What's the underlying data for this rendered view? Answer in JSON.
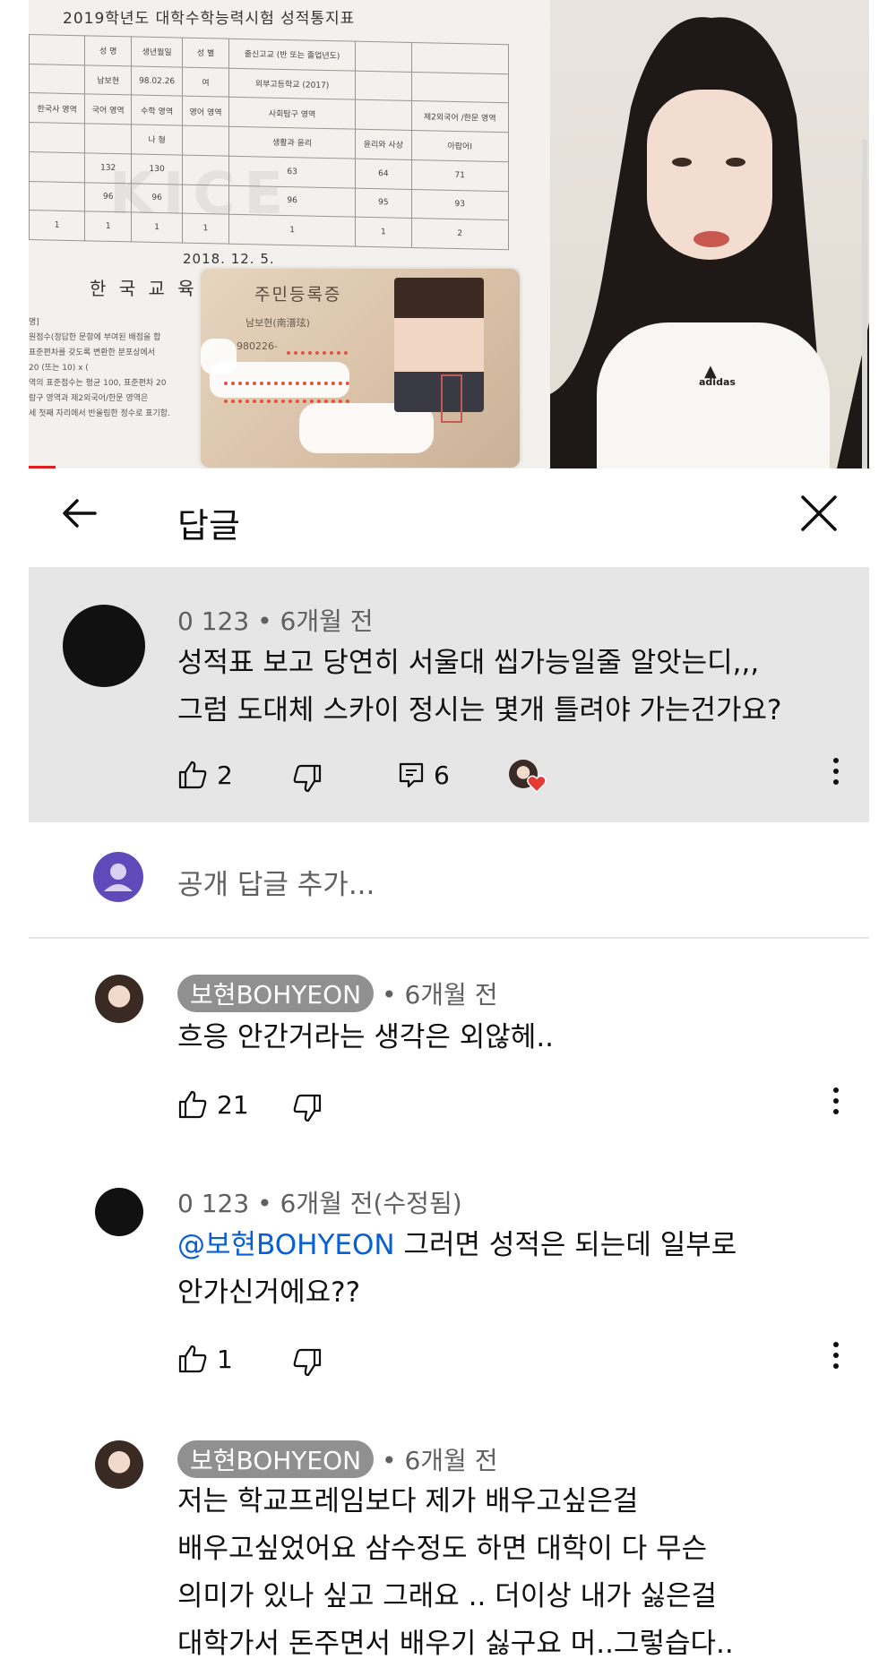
{
  "video_frame": {
    "document": {
      "title": "2019학년도 대학수학능력시험 성적통지표",
      "table_rows": [
        [
          "",
          "성 명",
          "생년월일",
          "성 별",
          "출신고교 (반 또는 졸업년도)",
          "",
          ""
        ],
        [
          "",
          "남보현",
          "98.02.26",
          "여",
          "외부고등학교 (2017)",
          "",
          ""
        ],
        [
          "한국사 영역",
          "국어 영역",
          "수학 영역",
          "영어 영역",
          "사회탐구 영역",
          "",
          "제2외국어 /한문 영역"
        ],
        [
          "",
          "",
          "나 형",
          "",
          "생활과 윤리",
          "윤리와 사상",
          "아랍어Ⅰ"
        ],
        [
          "",
          "132",
          "130",
          "",
          "63",
          "64",
          "71"
        ],
        [
          "",
          "96",
          "96",
          "",
          "96",
          "95",
          "93"
        ],
        [
          "1",
          "1",
          "1",
          "1",
          "1",
          "1",
          "2"
        ]
      ],
      "watermark": "KICE",
      "date": "2018. 12. 5.",
      "issuer": "한 국 교 육",
      "notes": "명]\n원점수(정답한 문항에 부여된 배점을 합\n표준편차를 갖도록 변환한 분포상에서\n20 (또는 10) x (\n역의 표준점수는 평균 100, 표준편차 20\n람구 영역과 제2외국어/한문 영역은\n세 첫째 자리에서 반올림한 정수로 표기함."
    },
    "id_card": {
      "title": "주민등록증",
      "name": "남보현(南潽玹)",
      "number": "980226-"
    },
    "person_shirt_logo": "adidas"
  },
  "header": {
    "back_icon": "arrow-left-icon",
    "title": "답글",
    "close_icon": "close-icon"
  },
  "comments": [
    {
      "author": "0 123",
      "time": "6개월 전",
      "is_creator": false,
      "lines": [
        "성적표 보고 당연히 서울대 씹가능일줄 알앗는디,,,",
        "그럼 도대체 스카이 정시는 몇개 틀려야 가는건가요?"
      ],
      "likes": "2",
      "replies": "6",
      "creator_hearted": true
    },
    {
      "author": "보현BOHYEON",
      "time": "6개월 전",
      "is_creator": true,
      "lines": [
        "흐응 안간거라는 생각은 외않헤.."
      ],
      "likes": "21"
    },
    {
      "author": "0 123",
      "time": "6개월 전(수정됨)",
      "is_creator": false,
      "mention": "@보현BOHYEON",
      "lines": [
        " 그러면 성적은 되는데 일부로",
        "안가신거에요??"
      ],
      "likes": "1"
    },
    {
      "author": "보현BOHYEON",
      "time": "6개월 전",
      "is_creator": true,
      "lines": [
        "저는 학교프레임보다 제가 배우고싶은걸",
        "배우고싶었어요 삼수정도 하면 대학이 다 무슨",
        "의미가 있나 싶고 그래요 .. 더이상 내가 싫은걸",
        "대학가서 돈주면서 배우기 싫구요 머..그렇습다.."
      ]
    }
  ],
  "add_reply": {
    "placeholder": "공개 답글 추가..."
  },
  "colors": {
    "highlight_bg": "#e6e6e6",
    "mention_link": "#065fd4",
    "creator_chip": "#909090",
    "progress_red": "#e02020",
    "reply_avatar": "#5e4ab8",
    "heart": "#e53935"
  }
}
